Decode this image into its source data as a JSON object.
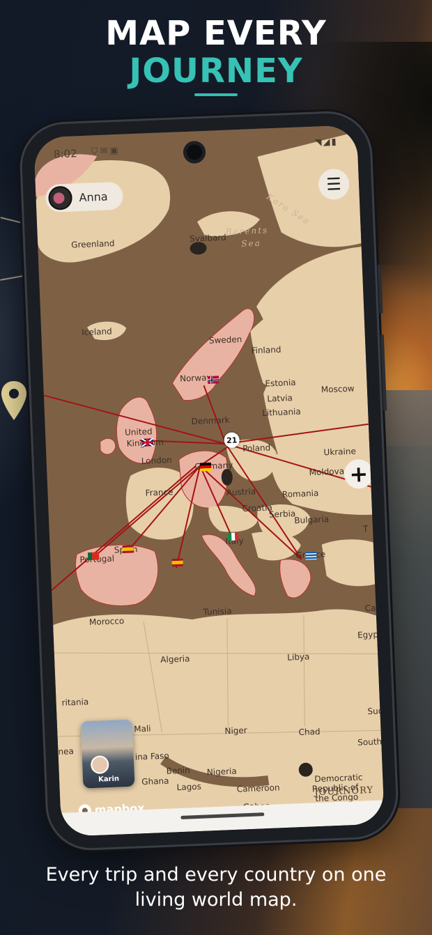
{
  "headline": {
    "line1": "MAP EVERY",
    "line2": "JOURNEY"
  },
  "tagline": "Every trip and every country on one living world map.",
  "colors": {
    "accent": "#36c2b4",
    "visited": "#e9b3a3",
    "route": "#a51212",
    "land": "#e7cfaa",
    "sea": "#7e6145"
  },
  "status_bar": {
    "time": "8:02",
    "left_icons": "shield-icon mail-icon photo-icon",
    "right_icons": "wifi-icon signal-icon battery-icon"
  },
  "user": {
    "name": "Anna"
  },
  "menu": {
    "icon": "hamburger-icon"
  },
  "add_button": {
    "label": "+"
  },
  "cluster": {
    "count": "21"
  },
  "photo_card": {
    "name": "Karin"
  },
  "mapbox": {
    "label": "mapbox"
  },
  "watermark": "JOURNORY",
  "map_labels": {
    "kara_sea": "Kara Sea",
    "barents_sea_1": "Barents",
    "barents_sea_2": "Sea",
    "greenland": "Greenland",
    "svalbard": "Svalbard",
    "iceland": "Iceland",
    "sweden": "Sweden",
    "finland": "Finland",
    "norway": "Norway",
    "estonia": "Estonia",
    "moscow": "Moscow",
    "latvia": "Latvia",
    "lithuania": "Lithuania",
    "denmark": "Denmark",
    "united_kingdom_1": "United",
    "united_kingdom_2": "Kingdom",
    "london": "London",
    "poland": "Poland",
    "ukraine": "Ukraine",
    "germany": "Germany",
    "moldova": "Moldova",
    "france": "France",
    "austria": "Austria",
    "romania": "Romania",
    "croatia": "Croatia",
    "serbia": "Serbia",
    "bulgaria": "Bulgaria",
    "portugal": "Portugal",
    "spain": "Spain",
    "italy": "Italy",
    "greece": "Greece",
    "turkey": "T",
    "morocco": "Morocco",
    "tunisia": "Tunisia",
    "cairo": "Ca",
    "egypt": "Egyp",
    "algeria": "Algeria",
    "libya": "Libya",
    "mauritania": "ritania",
    "sudan": "Sud",
    "mali": "Mali",
    "niger": "Niger",
    "chad": "Chad",
    "south_sudan": "South S",
    "burkina_faso": "ina Faso",
    "benin": "Benin",
    "nigeria": "Nigeria",
    "ghana": "Ghana",
    "lagos": "Lagos",
    "cameroon": "Cameroon",
    "gabon": "Gabon",
    "drc_1": "Democratic",
    "drc_2": "Republic of",
    "drc_3": "the Congo",
    "guinea": "nea"
  }
}
